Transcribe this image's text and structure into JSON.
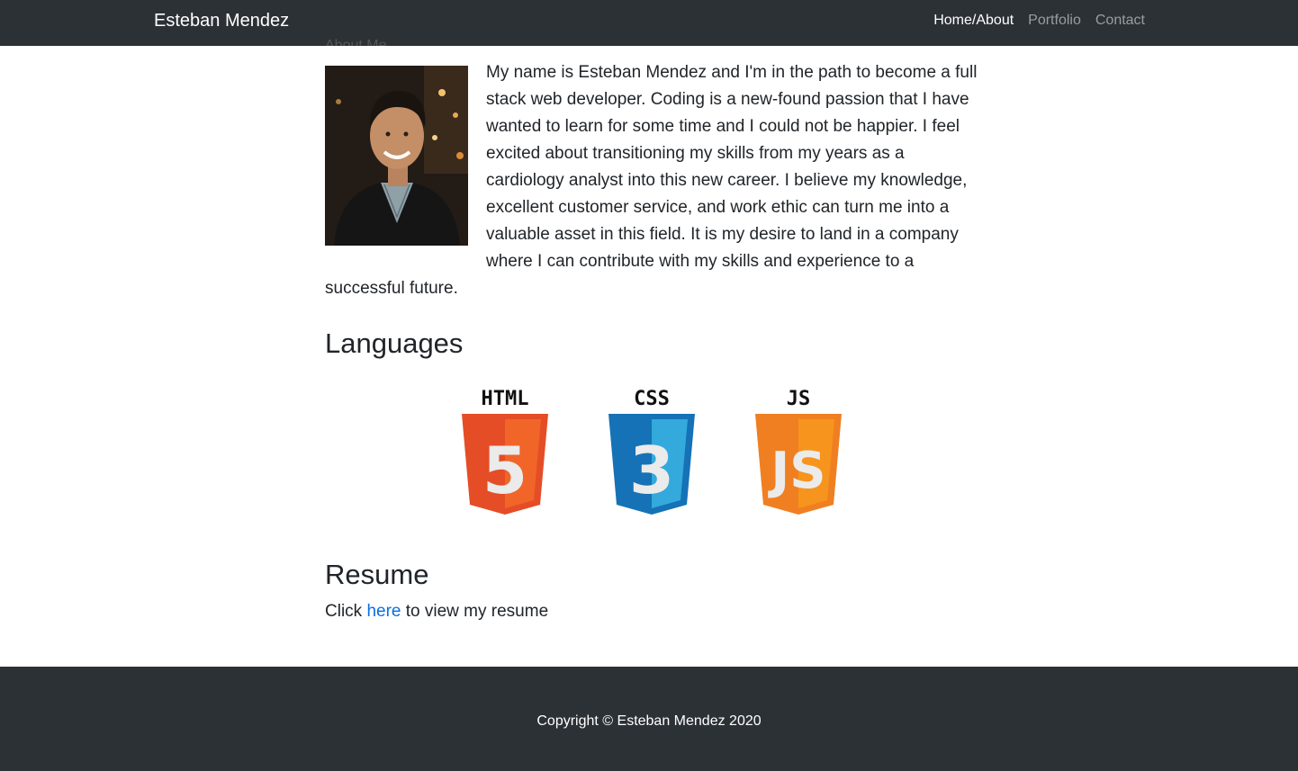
{
  "nav": {
    "brand": "Esteban Mendez",
    "links": [
      {
        "label": "Home/About",
        "active": true
      },
      {
        "label": "Portfolio",
        "active": false
      },
      {
        "label": "Contact",
        "active": false
      }
    ]
  },
  "about": {
    "clipped_heading": "About Me",
    "bio": "My name is Esteban Mendez and I'm in the path to become a full stack web developer. Coding is a new-found passion that I have wanted to learn for some time and I could not be happier. I feel excited about transitioning my skills from my years as a cardiology analyst into this new career. I believe my knowledge, excellent customer service, and work ethic can turn me into a valuable asset in this field. It is my desire to land in a company where I can contribute with my skills and experience to a successful future."
  },
  "languages": {
    "title": "Languages",
    "items": [
      {
        "label": "HTML",
        "number": "5",
        "icon": "html5-logo-icon",
        "color": "#e44d26",
        "color_light": "#f16529"
      },
      {
        "label": "CSS",
        "number": "3",
        "icon": "css3-logo-icon",
        "color": "#1572b6",
        "color_light": "#33a9dc"
      },
      {
        "label": "JS",
        "number": "JS",
        "icon": "js-logo-icon",
        "color": "#f07f22",
        "color_light": "#f7941d"
      }
    ]
  },
  "resume": {
    "title": "Resume",
    "prefix": "Click ",
    "link_text": "here",
    "suffix": " to view my resume"
  },
  "footer": {
    "copyright": "Copyright © Esteban Mendez 2020"
  },
  "colors": {
    "navbar_bg": "#2c3136",
    "link_blue": "#0b6ee0"
  }
}
